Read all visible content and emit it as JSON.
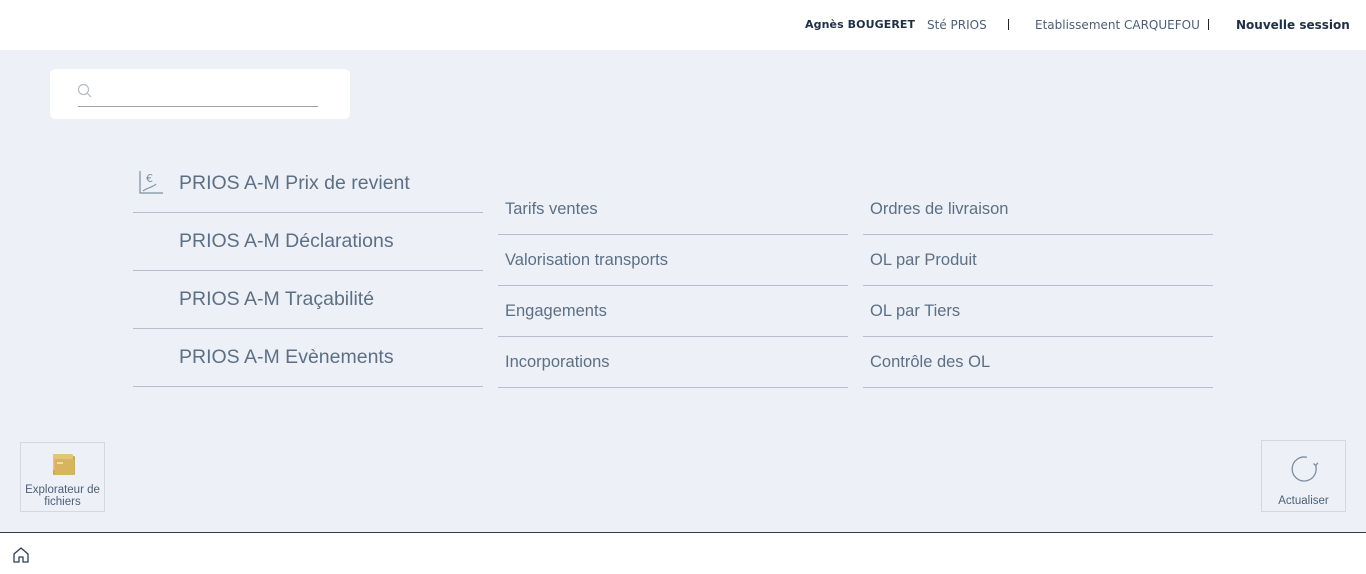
{
  "topbar": {
    "user": "Agnès BOUGERET",
    "company": "Sté PRIOS",
    "establishment": "Etablissement CARQUEFOU",
    "new_session": "Nouvelle session"
  },
  "search": {
    "placeholder": "",
    "value": "",
    "icon": "search-icon"
  },
  "modules": [
    {
      "label": "PRIOS A-M Prix de revient",
      "icon": "cost-price-chart-icon"
    },
    {
      "label": "PRIOS A-M Déclarations"
    },
    {
      "label": "PRIOS A-M Traçabilité"
    },
    {
      "label": "PRIOS A-M Evènements"
    }
  ],
  "submenu": {
    "column1": [
      {
        "label": "Tarifs ventes"
      },
      {
        "label": "Valorisation transports"
      },
      {
        "label": "Engagements"
      },
      {
        "label": "Incorporations"
      }
    ],
    "column2": [
      {
        "label": "Ordres de livraison"
      },
      {
        "label": "OL par Produit"
      },
      {
        "label": "OL par Tiers"
      },
      {
        "label": "Contrôle des OL"
      }
    ]
  },
  "tiles": {
    "explorer": {
      "label": "Explorateur de fichiers",
      "icon": "folder-icon"
    },
    "refresh": {
      "label": "Actualiser",
      "icon": "refresh-icon"
    }
  },
  "bottombar": {
    "home_icon": "home-icon"
  },
  "colors": {
    "background": "#edf1f7",
    "text": "#5d6f84",
    "divider": "#b7bec8",
    "dark": "#1f2f45",
    "folder": "#d4b25a"
  }
}
